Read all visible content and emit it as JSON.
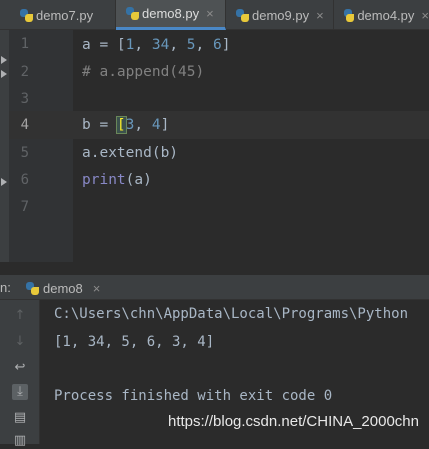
{
  "editor_tabs": [
    {
      "label": "demo7.py",
      "icon": "python-file-icon"
    },
    {
      "label": "demo8.py",
      "icon": "python-file-icon",
      "active": true
    },
    {
      "label": "demo9.py",
      "icon": "python-file-icon"
    },
    {
      "label": "demo4.py",
      "icon": "python-file-icon"
    }
  ],
  "tab_close_glyph": "×",
  "line_numbers": [
    "1",
    "2",
    "3",
    "4",
    "5",
    "6",
    "7"
  ],
  "code": {
    "l1_var": "a = [",
    "l1_n1": "1",
    "l1_sep1": ", ",
    "l1_n2": "34",
    "l1_sep2": ", ",
    "l1_n3": "5",
    "l1_sep3": ", ",
    "l1_n4": "6",
    "l1_end": "]",
    "l2_comment": "# a.append(45)",
    "l4_var": "b = ",
    "l4_open": "[",
    "l4_n1": "3",
    "l4_sep": ", ",
    "l4_n2": "4",
    "l4_close": "]",
    "l5": "a.extend(b)",
    "l6_fn": "print",
    "l6_args": "(a)"
  },
  "run_panel": {
    "prefix": "n:",
    "tab_label": "demo8",
    "console_lines": [
      "C:\\Users\\chn\\AppData\\Local\\Programs\\Python",
      "[1, 34, 5, 6, 3, 4]",
      "",
      "Process finished with exit code 0"
    ]
  },
  "toolbar_icons": [
    "up-arrow-icon",
    "down-arrow-icon",
    "soft-wrap-icon",
    "scroll-to-end-icon",
    "print-icon",
    "trash-icon"
  ],
  "watermark": "https://blog.csdn.net/CHINA_2000chn",
  "colors": {
    "background": "#2B2B2B",
    "gutter": "#313335",
    "number": "#6897BB",
    "comment": "#808080",
    "builtin": "#8888C6",
    "text": "#A9B7C6",
    "tab_underline": "#4A88C7"
  }
}
